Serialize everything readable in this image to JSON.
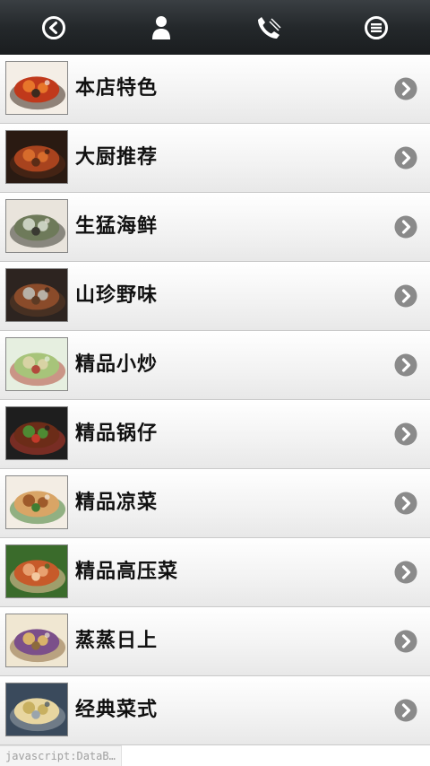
{
  "topbar": {
    "buttons": [
      {
        "icon": "back-icon"
      },
      {
        "icon": "user-icon"
      },
      {
        "icon": "phone-icon"
      },
      {
        "icon": "menu-icon"
      }
    ],
    "icon_color": "#ffffff"
  },
  "menu": {
    "items": [
      {
        "label": "本店特色",
        "thumb_colors": [
          "#f4eee6",
          "#c0391b",
          "#e7762b",
          "#3d2a1e"
        ]
      },
      {
        "label": "大厨推荐",
        "thumb_colors": [
          "#2a1a12",
          "#a8431e",
          "#d76c2c",
          "#5a2c16"
        ]
      },
      {
        "label": "生猛海鲜",
        "thumb_colors": [
          "#e9e4dc",
          "#6e7a5a",
          "#c9d0c0",
          "#3a3a32"
        ]
      },
      {
        "label": "山珍野味",
        "thumb_colors": [
          "#2d2420",
          "#8a4b2a",
          "#b7b0a6",
          "#5c3a24"
        ]
      },
      {
        "label": "精品小炒",
        "thumb_colors": [
          "#e6efe0",
          "#a7c47a",
          "#d8d3a4",
          "#b24a3c"
        ]
      },
      {
        "label": "精品锅仔",
        "thumb_colors": [
          "#1e1e1e",
          "#6c2c18",
          "#4e8a33",
          "#c23a2a"
        ]
      },
      {
        "label": "精品凉菜",
        "thumb_colors": [
          "#f3ede4",
          "#d9a566",
          "#9e5a2a",
          "#3f7d32"
        ]
      },
      {
        "label": "精品高压菜",
        "thumb_colors": [
          "#3a6b2b",
          "#c75a2a",
          "#e8a070",
          "#f3c9a0"
        ]
      },
      {
        "label": "蒸蒸日上",
        "thumb_colors": [
          "#f0e7d2",
          "#7b4f8a",
          "#d8b26a",
          "#8c6a3c"
        ]
      },
      {
        "label": "经典菜式",
        "thumb_colors": [
          "#3a4a5c",
          "#e8d6a0",
          "#c8b060",
          "#9aa4ac"
        ]
      }
    ],
    "arrow_color": "#8a8a8a"
  },
  "statusbar": {
    "url_text": "javascript:DataB…"
  }
}
